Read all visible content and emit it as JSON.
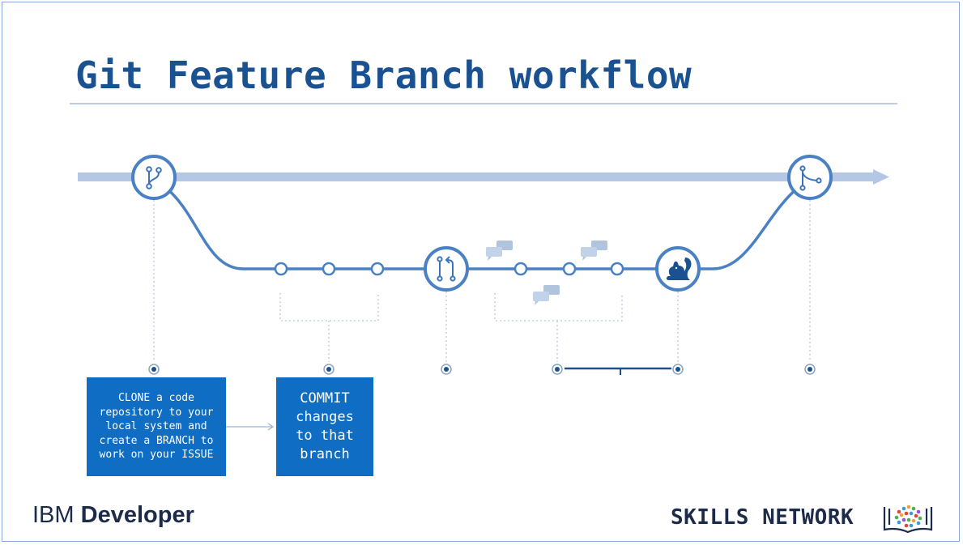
{
  "slide": {
    "title": "Git Feature Branch workflow"
  },
  "boxes": {
    "clone_text": "CLONE a code\nrepository to your\nlocal system and\ncreate a BRANCH to\nwork on your ISSUE",
    "commit_text": "COMMIT\nchanges\nto that\nbranch"
  },
  "footer": {
    "brand_left_part1": "IBM ",
    "brand_left_part2": "Developer",
    "brand_right": "SKILLS NETWORK"
  },
  "colors": {
    "primary_blue": "#1a5190",
    "box_blue": "#0f6dc4",
    "line_blue": "#4a80c4",
    "main_line": "#b4c8e6"
  },
  "icons": [
    "branch-icon",
    "pull-request-icon",
    "squirrel-icon",
    "merge-icon",
    "chat-bubble-icon"
  ]
}
